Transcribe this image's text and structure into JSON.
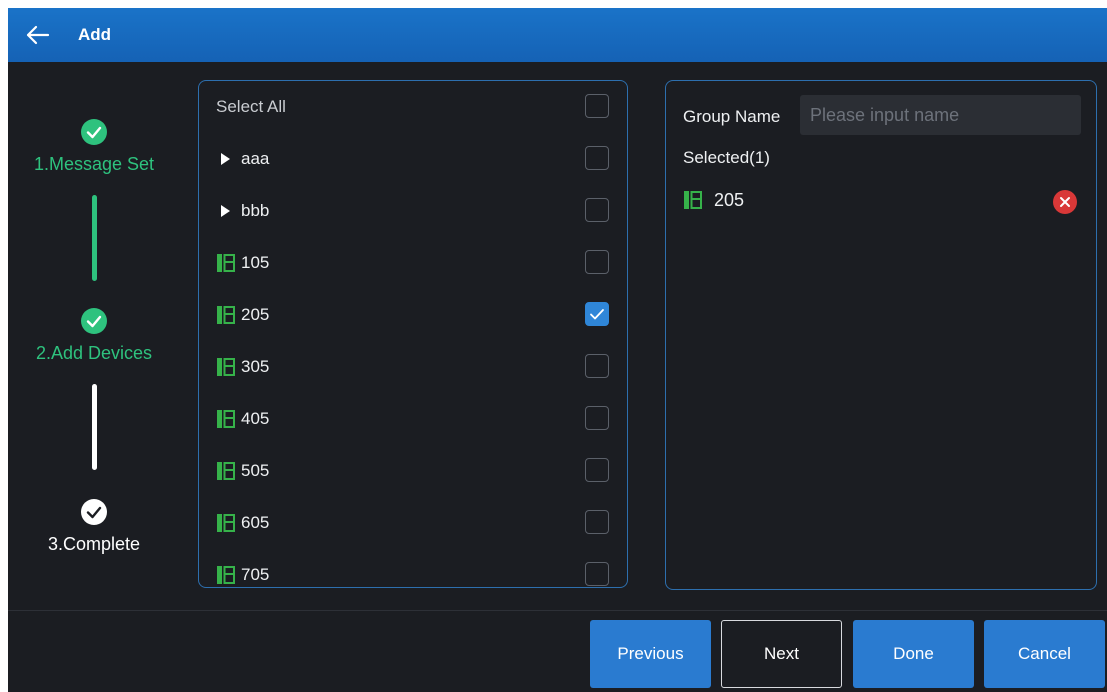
{
  "header": {
    "title": "Add"
  },
  "steps": [
    {
      "label": "1.Message Set",
      "state": "done"
    },
    {
      "label": "2.Add Devices",
      "state": "done"
    },
    {
      "label": "3.Complete",
      "state": "pending"
    }
  ],
  "colors": {
    "accent": "#1a73c8",
    "step_done": "#2ec27e",
    "step_pending": "#ffffff",
    "device_icon": "#36b24a",
    "remove": "#d93838",
    "checkbox_on": "#2f86d8"
  },
  "device_list": {
    "select_all_label": "Select All",
    "select_all_checked": false,
    "groups": [
      {
        "name": "aaa",
        "checked": false
      },
      {
        "name": "bbb",
        "checked": false
      }
    ],
    "devices": [
      {
        "name": "105",
        "checked": false
      },
      {
        "name": "205",
        "checked": true
      },
      {
        "name": "305",
        "checked": false
      },
      {
        "name": "405",
        "checked": false
      },
      {
        "name": "505",
        "checked": false
      },
      {
        "name": "605",
        "checked": false
      },
      {
        "name": "705",
        "checked": false
      }
    ]
  },
  "selection": {
    "group_name_label": "Group Name",
    "group_name_value": "",
    "group_name_placeholder": "Please input name",
    "selected_label": "Selected(1)",
    "items": [
      {
        "name": "205"
      }
    ]
  },
  "footer": {
    "previous_label": "Previous",
    "next_label": "Next",
    "done_label": "Done",
    "cancel_label": "Cancel"
  }
}
